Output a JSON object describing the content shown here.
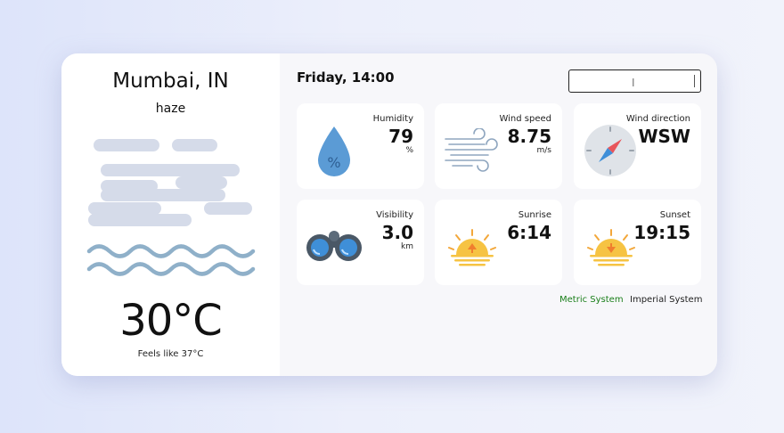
{
  "location": {
    "city": "Mumbai, IN",
    "description": "haze"
  },
  "current": {
    "temperature": "30°C",
    "feels_like": "Feels like 37°C"
  },
  "date_time": "Friday, 14:00",
  "search": {
    "value": "",
    "placeholder": ""
  },
  "tiles": [
    {
      "label": "Humidity",
      "value": "79",
      "unit": "%",
      "icon": "humidity-drop-icon"
    },
    {
      "label": "Wind speed",
      "value": "8.75",
      "unit": "m/s",
      "icon": "wind-icon"
    },
    {
      "label": "Wind direction",
      "value": "WSW",
      "unit": "",
      "icon": "compass-icon"
    },
    {
      "label": "Visibility",
      "value": "3.0",
      "unit": "km",
      "icon": "binoculars-icon"
    },
    {
      "label": "Sunrise",
      "value": "6:14",
      "unit": "",
      "icon": "sunrise-icon"
    },
    {
      "label": "Sunset",
      "value": "19:15",
      "unit": "",
      "icon": "sunset-icon"
    }
  ],
  "unit_system": {
    "metric": "Metric System",
    "imperial": "Imperial System",
    "active": "metric"
  },
  "colors": {
    "active_unit": "#1a7f1a",
    "haze": "#d5dbe9",
    "waves": "#8fb0c9",
    "sun": "#f6c343",
    "sun_rays": "#f3a73a",
    "drop": "#5b9bd5",
    "compass_red": "#e8555a",
    "compass_blue": "#3f8fd8"
  }
}
